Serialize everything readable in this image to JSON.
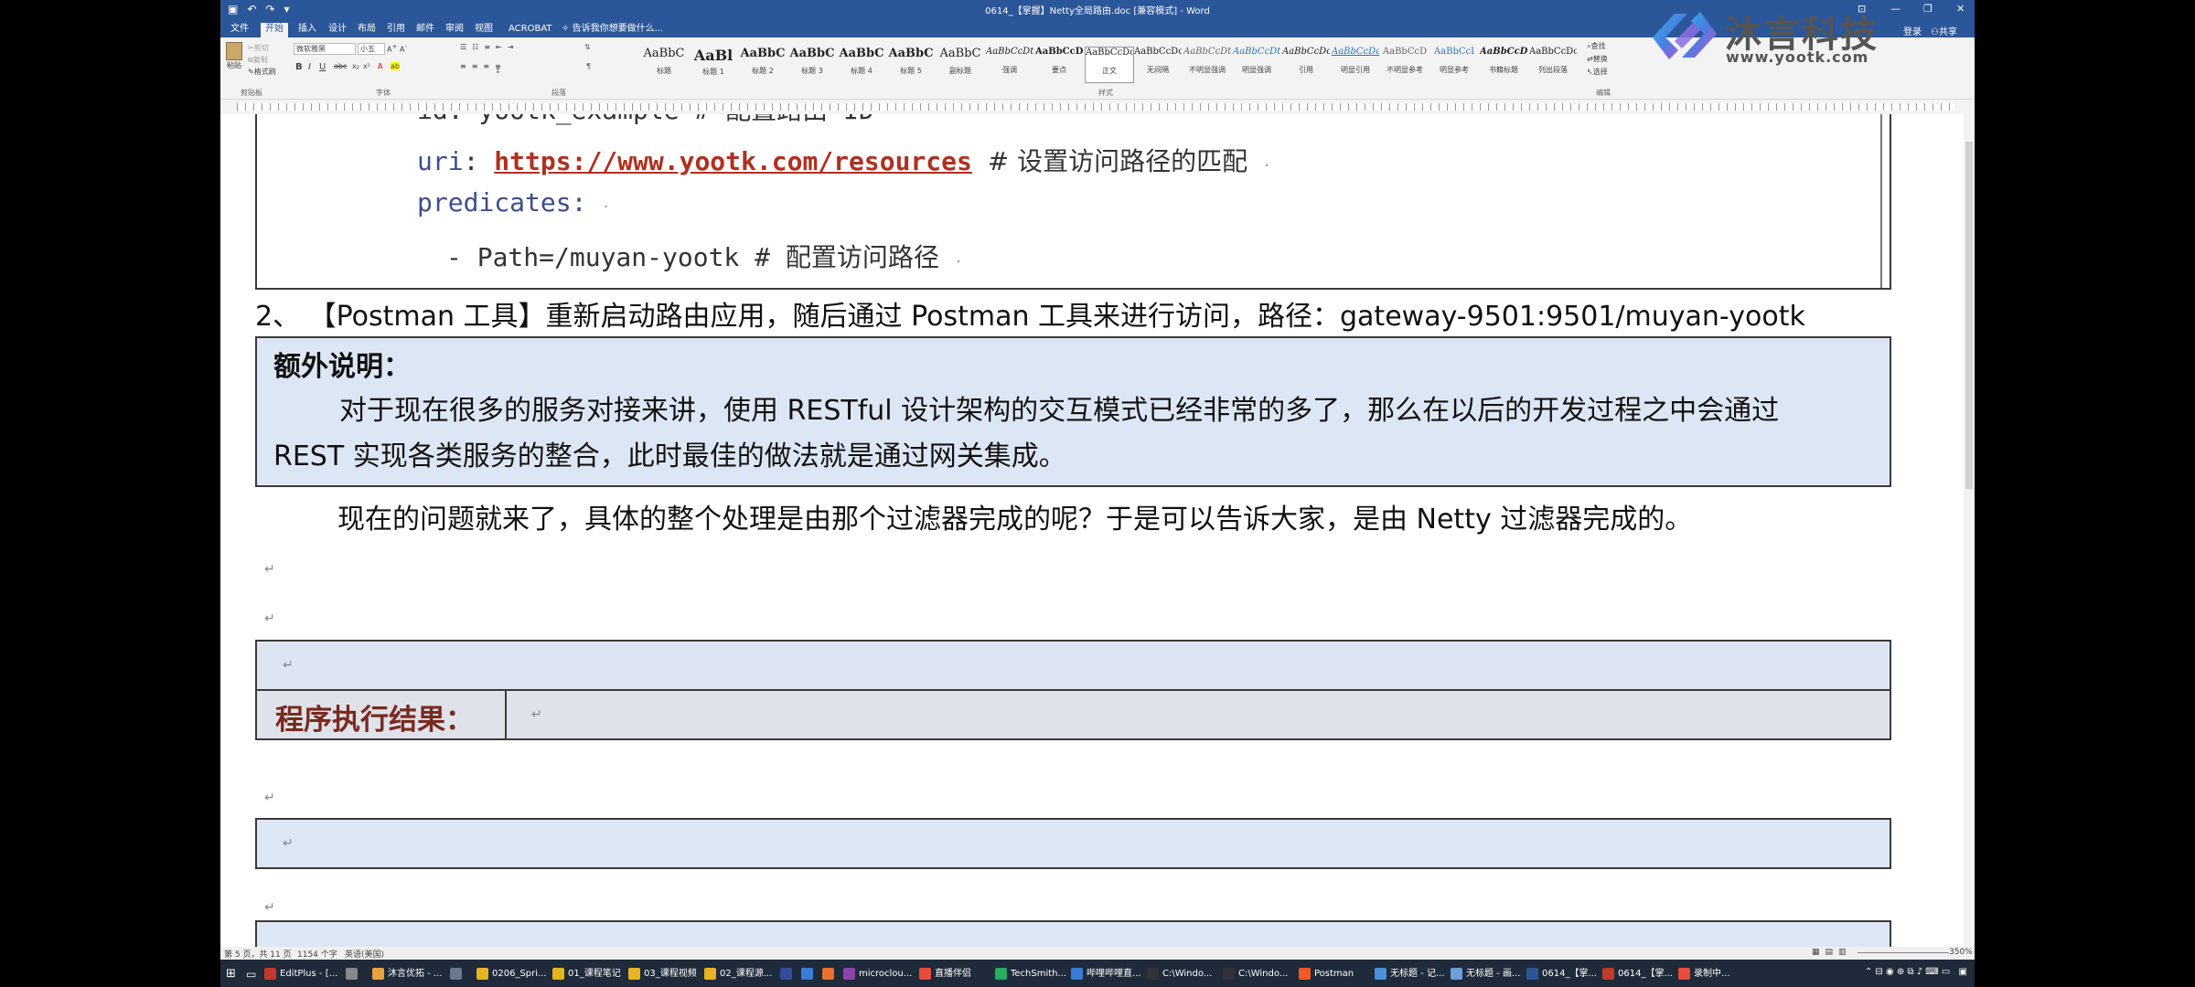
{
  "window": {
    "title": "0614_【掌握】Netty全局路由.doc [兼容模式] - Word",
    "qat_icons": [
      "save-icon",
      "undo-icon",
      "redo-icon",
      "customize-icon"
    ],
    "min": "—",
    "restore": "❐",
    "close": "✕",
    "ribbon_display": "⊡"
  },
  "tabs": [
    "文件",
    "开始",
    "插入",
    "设计",
    "布局",
    "引用",
    "邮件",
    "审阅",
    "视图",
    "ACROBAT"
  ],
  "tell_me": "告诉我你想要做什么...",
  "account": {
    "login": "登录",
    "share": "共享"
  },
  "ribbon": {
    "clipboard": {
      "paste": "粘贴",
      "cut": "剪切",
      "copy": "复制",
      "format": "格式刷",
      "label": "剪贴板"
    },
    "font": {
      "name": "微软雅黑",
      "size": "小五",
      "label": "字体"
    },
    "paragraph": {
      "label": "段落"
    },
    "styles": {
      "label": "样式",
      "items": [
        {
          "sample": "AaBbC",
          "name": "标题"
        },
        {
          "sample": "AaBl",
          "name": "标题 1"
        },
        {
          "sample": "AaBbC",
          "name": "标题 2"
        },
        {
          "sample": "AaBbC",
          "name": "标题 3"
        },
        {
          "sample": "AaBbC",
          "name": "标题 4"
        },
        {
          "sample": "AaBbC",
          "name": "标题 5"
        },
        {
          "sample": "AaBbC",
          "name": "副标题"
        },
        {
          "sample": "AaBbCcDt",
          "name": "强调"
        },
        {
          "sample": "AaBbCcD",
          "name": "要点"
        },
        {
          "sample": "AaBbCcDc",
          "name": "正文"
        },
        {
          "sample": "AaBbCcDc",
          "name": "无间隔"
        },
        {
          "sample": "AaBbCcDt",
          "name": "不明显强调"
        },
        {
          "sample": "AaBbCcDt",
          "name": "明显强调"
        },
        {
          "sample": "AaBbCcDc",
          "name": "引用"
        },
        {
          "sample": "AaBbCcDc",
          "name": "明显引用"
        },
        {
          "sample": "AaBbCcD",
          "name": "不明显参考"
        },
        {
          "sample": "AaBbCcI",
          "name": "明显参考"
        },
        {
          "sample": "AaBbCcDi",
          "name": "书籍标题"
        },
        {
          "sample": "AaBbCcDc",
          "name": "列出段落"
        }
      ]
    },
    "editing": {
      "find": "查找",
      "replace": "替换",
      "select": "选择",
      "label": "编辑"
    }
  },
  "logo": {
    "brand": "沐言科技",
    "url": "www.yootk.com"
  },
  "document": {
    "code": {
      "line0": "id: yootk_example # 配置路由 ID",
      "uri_key": "uri",
      "uri_value": "https://www.yootk.com/resources",
      "uri_comment": "# 设置访问路径的匹配",
      "predicates": "predicates:",
      "path": "- Path=/muyan-yootk # 配置访问路径"
    },
    "step2": "2、 【Postman 工具】重新启动路由应用，随后通过 Postman 工具来进行访问，路径：gateway-9501:9501/muyan-yootk",
    "note": {
      "heading": "额外说明：",
      "line1": "对于现在很多的服务对接来讲，使用 RESTful 设计架构的交互模式已经非常的多了，那么在以后的开发过程之中会通过",
      "line2": "REST 实现各类服务的整合，此时最佳的做法就是通过网关集成。"
    },
    "question": "现在的问题就来了，具体的整个处理是由那个过滤器完成的呢？于是可以告诉大家，是由 Netty 过滤器完成的。",
    "result_label": "程序执行结果："
  },
  "status": {
    "page": "第 5 页，共 11 页",
    "words": "1154 个字",
    "lang": "英语(美国)",
    "zoom": "350%"
  },
  "taskbar": {
    "items": [
      {
        "label": "EditPlus - [...",
        "color": "#c0392b"
      },
      {
        "label": "",
        "color": "#888888"
      },
      {
        "label": "沐言优拓 - ...",
        "color": "#e8a33d"
      },
      {
        "label": "",
        "color": "#6a7a8a"
      },
      {
        "label": "0206_Spri...",
        "color": "#e6b422"
      },
      {
        "label": "01_课程笔记",
        "color": "#e6b422"
      },
      {
        "label": "03_课程视频",
        "color": "#e6b422"
      },
      {
        "label": "02_课程源...",
        "color": "#e6b422"
      },
      {
        "label": "",
        "color": "#2f4d9a"
      },
      {
        "label": "",
        "color": "#3a7bd5"
      },
      {
        "label": "",
        "color": "#e8702a"
      },
      {
        "label": "microclou...",
        "color": "#8e44ad"
      },
      {
        "label": "直播伴侣",
        "color": "#e74c3c"
      },
      {
        "label": "TechSmith...",
        "color": "#27ae60"
      },
      {
        "label": "哔哩哔哩直...",
        "color": "#3a7bd5"
      },
      {
        "label": "C:\\Windo...",
        "color": "#333333"
      },
      {
        "label": "C:\\Windo...",
        "color": "#333333"
      },
      {
        "label": "Postman",
        "color": "#ef5b25"
      },
      {
        "label": "无标题 - 记...",
        "color": "#4a90d9"
      },
      {
        "label": "无标题 - 画...",
        "color": "#6c9fd8"
      },
      {
        "label": "0614_【掌...",
        "color": "#2b579a"
      },
      {
        "label": "0614_【掌...",
        "color": "#c0392b"
      },
      {
        "label": "录制中...",
        "color": "#e74c3c"
      }
    ]
  }
}
